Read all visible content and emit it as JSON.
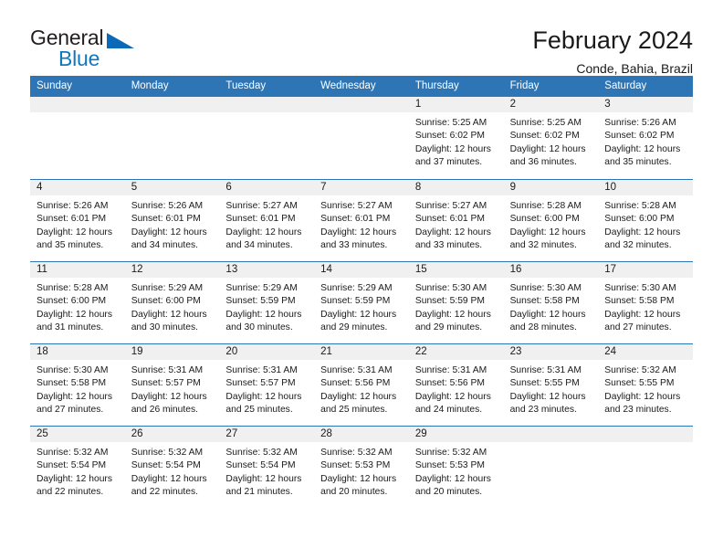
{
  "logo": {
    "word_top": "General",
    "word_bottom": "Blue",
    "triangle_icon": "triangle-icon",
    "accent_color": "#1278be"
  },
  "header": {
    "title": "February 2024",
    "subtitle": "Conde, Bahia, Brazil"
  },
  "theme": {
    "header_blue": "#2e75b6",
    "daybar_gray": "#f0f0f0",
    "text": "#1a1a1a"
  },
  "weekdays": [
    "Sunday",
    "Monday",
    "Tuesday",
    "Wednesday",
    "Thursday",
    "Friday",
    "Saturday"
  ],
  "weeks": [
    [
      {
        "day": "",
        "lines": []
      },
      {
        "day": "",
        "lines": []
      },
      {
        "day": "",
        "lines": []
      },
      {
        "day": "",
        "lines": []
      },
      {
        "day": "1",
        "lines": [
          "Sunrise: 5:25 AM",
          "Sunset: 6:02 PM",
          "Daylight: 12 hours",
          "and 37 minutes."
        ]
      },
      {
        "day": "2",
        "lines": [
          "Sunrise: 5:25 AM",
          "Sunset: 6:02 PM",
          "Daylight: 12 hours",
          "and 36 minutes."
        ]
      },
      {
        "day": "3",
        "lines": [
          "Sunrise: 5:26 AM",
          "Sunset: 6:02 PM",
          "Daylight: 12 hours",
          "and 35 minutes."
        ]
      }
    ],
    [
      {
        "day": "4",
        "lines": [
          "Sunrise: 5:26 AM",
          "Sunset: 6:01 PM",
          "Daylight: 12 hours",
          "and 35 minutes."
        ]
      },
      {
        "day": "5",
        "lines": [
          "Sunrise: 5:26 AM",
          "Sunset: 6:01 PM",
          "Daylight: 12 hours",
          "and 34 minutes."
        ]
      },
      {
        "day": "6",
        "lines": [
          "Sunrise: 5:27 AM",
          "Sunset: 6:01 PM",
          "Daylight: 12 hours",
          "and 34 minutes."
        ]
      },
      {
        "day": "7",
        "lines": [
          "Sunrise: 5:27 AM",
          "Sunset: 6:01 PM",
          "Daylight: 12 hours",
          "and 33 minutes."
        ]
      },
      {
        "day": "8",
        "lines": [
          "Sunrise: 5:27 AM",
          "Sunset: 6:01 PM",
          "Daylight: 12 hours",
          "and 33 minutes."
        ]
      },
      {
        "day": "9",
        "lines": [
          "Sunrise: 5:28 AM",
          "Sunset: 6:00 PM",
          "Daylight: 12 hours",
          "and 32 minutes."
        ]
      },
      {
        "day": "10",
        "lines": [
          "Sunrise: 5:28 AM",
          "Sunset: 6:00 PM",
          "Daylight: 12 hours",
          "and 32 minutes."
        ]
      }
    ],
    [
      {
        "day": "11",
        "lines": [
          "Sunrise: 5:28 AM",
          "Sunset: 6:00 PM",
          "Daylight: 12 hours",
          "and 31 minutes."
        ]
      },
      {
        "day": "12",
        "lines": [
          "Sunrise: 5:29 AM",
          "Sunset: 6:00 PM",
          "Daylight: 12 hours",
          "and 30 minutes."
        ]
      },
      {
        "day": "13",
        "lines": [
          "Sunrise: 5:29 AM",
          "Sunset: 5:59 PM",
          "Daylight: 12 hours",
          "and 30 minutes."
        ]
      },
      {
        "day": "14",
        "lines": [
          "Sunrise: 5:29 AM",
          "Sunset: 5:59 PM",
          "Daylight: 12 hours",
          "and 29 minutes."
        ]
      },
      {
        "day": "15",
        "lines": [
          "Sunrise: 5:30 AM",
          "Sunset: 5:59 PM",
          "Daylight: 12 hours",
          "and 29 minutes."
        ]
      },
      {
        "day": "16",
        "lines": [
          "Sunrise: 5:30 AM",
          "Sunset: 5:58 PM",
          "Daylight: 12 hours",
          "and 28 minutes."
        ]
      },
      {
        "day": "17",
        "lines": [
          "Sunrise: 5:30 AM",
          "Sunset: 5:58 PM",
          "Daylight: 12 hours",
          "and 27 minutes."
        ]
      }
    ],
    [
      {
        "day": "18",
        "lines": [
          "Sunrise: 5:30 AM",
          "Sunset: 5:58 PM",
          "Daylight: 12 hours",
          "and 27 minutes."
        ]
      },
      {
        "day": "19",
        "lines": [
          "Sunrise: 5:31 AM",
          "Sunset: 5:57 PM",
          "Daylight: 12 hours",
          "and 26 minutes."
        ]
      },
      {
        "day": "20",
        "lines": [
          "Sunrise: 5:31 AM",
          "Sunset: 5:57 PM",
          "Daylight: 12 hours",
          "and 25 minutes."
        ]
      },
      {
        "day": "21",
        "lines": [
          "Sunrise: 5:31 AM",
          "Sunset: 5:56 PM",
          "Daylight: 12 hours",
          "and 25 minutes."
        ]
      },
      {
        "day": "22",
        "lines": [
          "Sunrise: 5:31 AM",
          "Sunset: 5:56 PM",
          "Daylight: 12 hours",
          "and 24 minutes."
        ]
      },
      {
        "day": "23",
        "lines": [
          "Sunrise: 5:31 AM",
          "Sunset: 5:55 PM",
          "Daylight: 12 hours",
          "and 23 minutes."
        ]
      },
      {
        "day": "24",
        "lines": [
          "Sunrise: 5:32 AM",
          "Sunset: 5:55 PM",
          "Daylight: 12 hours",
          "and 23 minutes."
        ]
      }
    ],
    [
      {
        "day": "25",
        "lines": [
          "Sunrise: 5:32 AM",
          "Sunset: 5:54 PM",
          "Daylight: 12 hours",
          "and 22 minutes."
        ]
      },
      {
        "day": "26",
        "lines": [
          "Sunrise: 5:32 AM",
          "Sunset: 5:54 PM",
          "Daylight: 12 hours",
          "and 22 minutes."
        ]
      },
      {
        "day": "27",
        "lines": [
          "Sunrise: 5:32 AM",
          "Sunset: 5:54 PM",
          "Daylight: 12 hours",
          "and 21 minutes."
        ]
      },
      {
        "day": "28",
        "lines": [
          "Sunrise: 5:32 AM",
          "Sunset: 5:53 PM",
          "Daylight: 12 hours",
          "and 20 minutes."
        ]
      },
      {
        "day": "29",
        "lines": [
          "Sunrise: 5:32 AM",
          "Sunset: 5:53 PM",
          "Daylight: 12 hours",
          "and 20 minutes."
        ]
      },
      {
        "day": "",
        "lines": []
      },
      {
        "day": "",
        "lines": []
      }
    ]
  ]
}
